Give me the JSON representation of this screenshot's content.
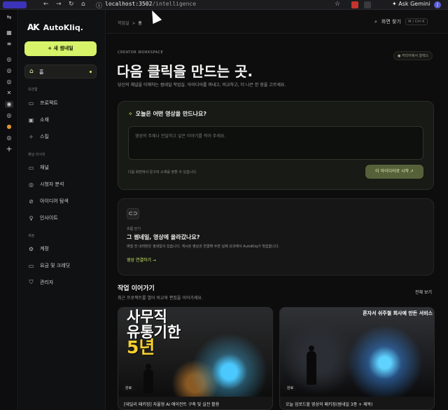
{
  "browser": {
    "url_host": "localhost:3502",
    "url_path": "/intelligence",
    "ask_gemini": "Ask Gemini",
    "profile_initial": "J"
  },
  "brand": {
    "mark": "AK",
    "name": "AutoKliq."
  },
  "sidebar": {
    "new_button": "+ 새 썸네일",
    "home": "홈",
    "sections": [
      {
        "title": "보관함",
        "items": [
          {
            "label": "프로젝트",
            "icon": "folder-icon"
          },
          {
            "label": "소재",
            "icon": "image-icon"
          },
          {
            "label": "스킬",
            "icon": "sparkle-icon"
          }
        ]
      },
      {
        "title": "채널 리서치",
        "items": [
          {
            "label": "채널",
            "icon": "tv-icon"
          },
          {
            "label": "시청자 분석",
            "icon": "globe-icon"
          },
          {
            "label": "아이디어 탐색",
            "icon": "compass-icon"
          },
          {
            "label": "인사이트",
            "icon": "lightbulb-icon"
          }
        ]
      },
      {
        "title": "계정",
        "items": [
          {
            "label": "계정",
            "icon": "gear-icon"
          },
          {
            "label": "요금 및 크레딧",
            "icon": "card-icon"
          },
          {
            "label": "관리자",
            "icon": "shield-icon"
          }
        ]
      }
    ]
  },
  "topbar": {
    "breadcrumb_root": "작업실",
    "breadcrumb_sep": ">",
    "breadcrumb_current": "홈",
    "search_label": "화면 찾기",
    "search_shortcut": "⌘ / Ctrl K"
  },
  "main": {
    "eyebrow": "CREATOR WORKSPACE",
    "status_badge": "● 커리어에서 알렉스",
    "title": "다음 클릭을 만드는 곳.",
    "subtitle": "당신의 채널을 이해하는 썸네일 작업실. 아이디어를 꺼내고, 비교하고, 더 나은 한 장을 고르세요.",
    "prompt_card": {
      "question": "오늘은 어떤 영상을 만드나요?",
      "placeholder": "영상의 주제나 전달하고 싶은 이야기를 적어 주세요.",
      "hint": "다음 화면에서 문구와 소재를 정할 수 있습니다.",
      "submit": "이 아이디어로 시작 ↗"
    },
    "connect_card": {
      "eyebrow": "흐름 닫기",
      "title": "그 썸네일, 영상에 올라갔나요?",
      "desc": "며칠 전 내려받은 썸네일이 있습니다. 게시된 영상과 연결해 두면 실제 성과에서 AutoKliq가 학습합니다.",
      "action": "영상 연결하기 →"
    },
    "continue": {
      "title": "작업 이어가기",
      "subtitle": "최근 프로젝트를 열어 비교와 편집을 이어가세요.",
      "see_all": "전체 보기",
      "projects": [
        {
          "thumb_line1": "사무직",
          "thumb_line2": "유통기한",
          "thumb_line3": "5년",
          "status": "완료",
          "title": "[데일리 패키징] 자율형 AI 에이전트 구축 및 실전 활용"
        },
        {
          "thumb_top": "혼자서 쉬주철 회사에 만든 서비스",
          "status": "완료",
          "title": "오늘 업로드할 영상의 패키징(썸네일 3종 + 제목)"
        }
      ]
    }
  },
  "colors": {
    "accent": "#d6f36a",
    "bg": "#0d0d0e",
    "card": "#171a15"
  }
}
